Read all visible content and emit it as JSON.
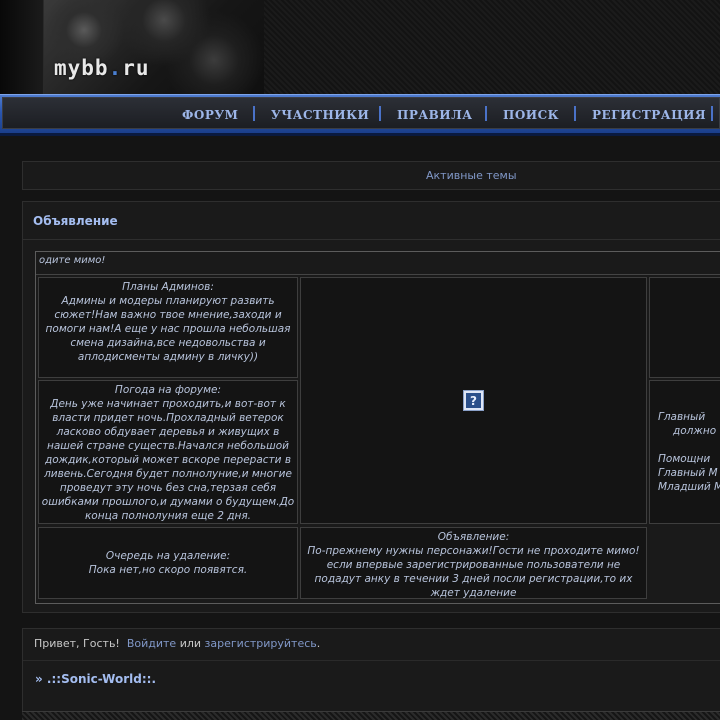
{
  "header": {
    "logo_main": "mybb",
    "logo_dot": ".",
    "logo_tld": "ru"
  },
  "nav": {
    "items": [
      {
        "label": "ФОРУМ"
      },
      {
        "label": "УЧАСТНИКИ"
      },
      {
        "label": "ПРАВИЛА"
      },
      {
        "label": "ПОИСК"
      },
      {
        "label": "РЕГИСТРАЦИЯ"
      }
    ]
  },
  "active_topics": {
    "label": "Активные темы"
  },
  "announcement": {
    "title": "Объявление",
    "marquee": "одите мимо!",
    "plans": {
      "title": "Планы Админов:",
      "text": "Админы и модеры планируют развить сюжет!Нам важно твое мнение,заходи и помоги нам!А еще у нас прошла небольшая смена дизайна,все недовольства и аплодисменты админу в личку))"
    },
    "weather": {
      "title": "Погода на форуме:",
      "text": "День уже начинает проходить,и вот-вот к власти придет ночь.Прохладный ветерок ласково обдувает деревья и живущих в нашей стране существ.Начался небольшой дождик,который может вскоре перерасти в ливень.Сегодня будет полнолуние,и многие проведут эту ночь без сна,терзая себя ошибками прошлого,и думами о будущем.До конца полнолуния еще 2 дня."
    },
    "queue": {
      "title": "Очередь на удаление:",
      "text": "Пока нет,но скоро появятся."
    },
    "notice": {
      "title": "Объявление:",
      "text": "По-прежнему нужны персонажи!Гости не проходите мимо!если впервые зарегистрированные пользователи не подадут анку в течении 3 дней посли регистрации,то их ждет удаление"
    },
    "staff": {
      "line1": "Главный",
      "line2": "должно",
      "line3": "Помощни",
      "line4": "Главный М",
      "line5": "Младший М"
    },
    "image_icon": "?"
  },
  "guest": {
    "greeting": "Привет, Гость!",
    "login_link": "Войдите",
    "or": "или",
    "register_link": "зарегистрируйтесь",
    "period": "."
  },
  "breadcrumb": {
    "label": "» .::Sonic-World::."
  },
  "colors": {
    "accent": "#4a72c8",
    "link": "#8198c8",
    "heading": "#a4bdf0",
    "background": "#141414"
  }
}
